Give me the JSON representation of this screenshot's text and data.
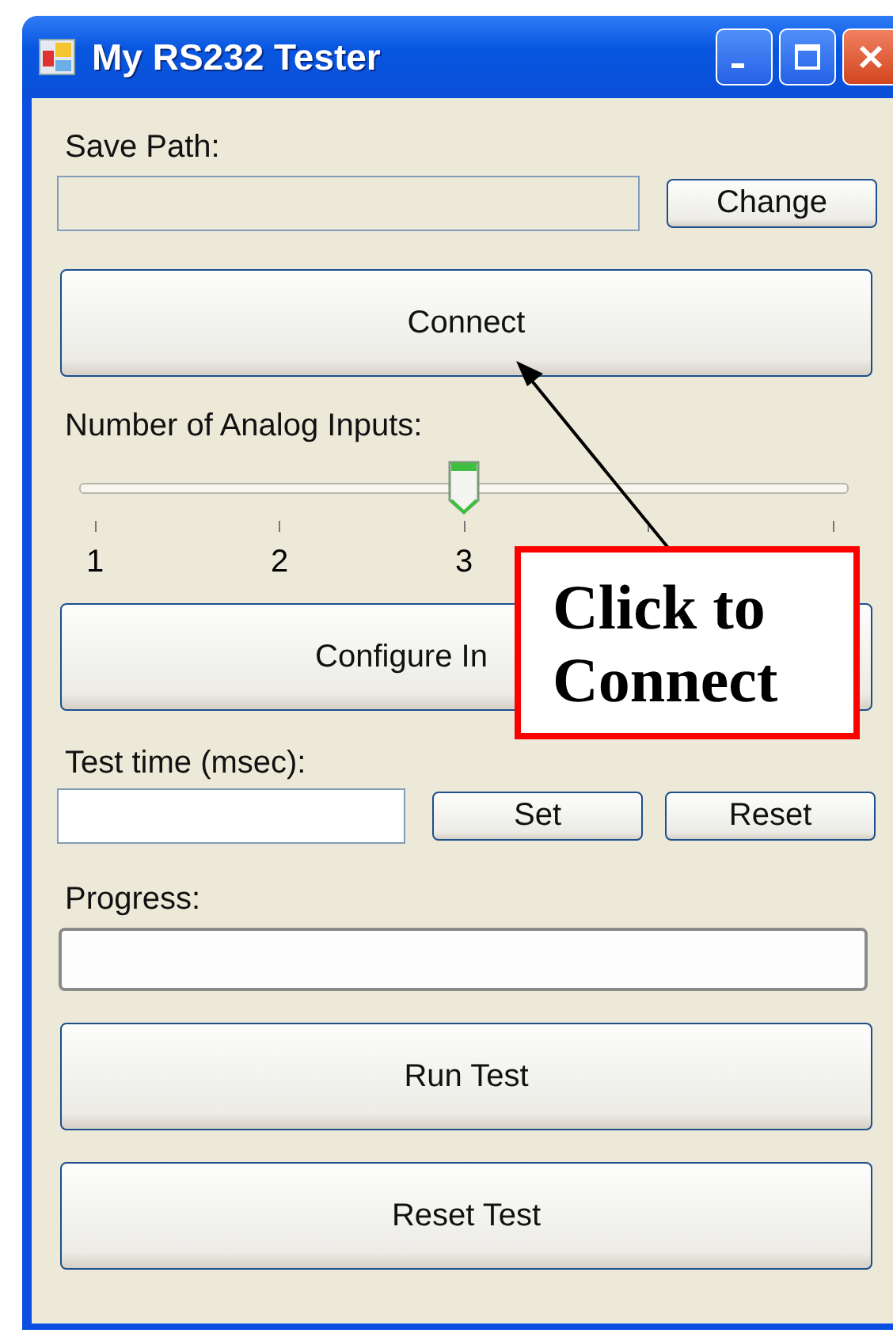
{
  "window": {
    "title": "My RS232 Tester"
  },
  "save_path": {
    "label": "Save Path:",
    "button": "Change"
  },
  "connect_button": "Connect",
  "analog_inputs": {
    "label": "Number of Analog Inputs:",
    "level": 0.5,
    "tick_labels": [
      "1",
      "2",
      "3"
    ]
  },
  "configure_button": "Configure In",
  "test_time": {
    "label": "Test time (msec):",
    "buttons": [
      "Set",
      "Reset"
    ]
  },
  "progress": {
    "label": "Progress:"
  },
  "actions": [
    "Run Test",
    "Reset Test"
  ],
  "callout": {
    "lines": [
      "Click to",
      "Connect"
    ]
  }
}
